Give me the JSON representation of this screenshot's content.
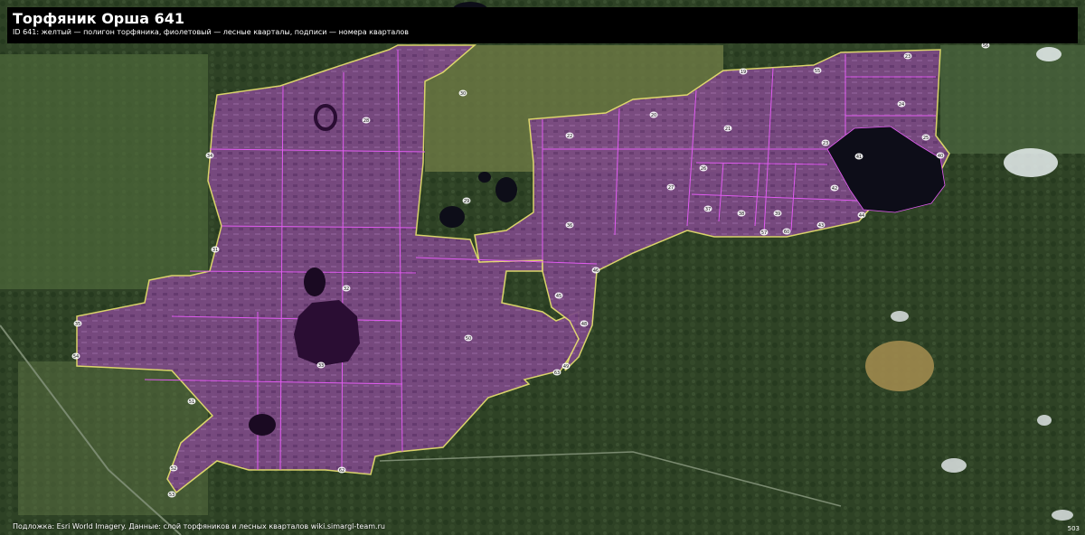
{
  "header": {
    "title": "Торфяник Орша 641",
    "subtitle": "ID 641: желтый — полигон торфяника, фиолетовый — лесные кварталы, подписи — номера кварталов"
  },
  "footer": {
    "attribution": "Подложка: Esri World Imagery. Данные: слой торфяников и лесных кварталов wiki.simargl-team.ru",
    "corner_label": "503"
  },
  "colors": {
    "peat_polygon": "#e8e070",
    "forest_quarter_fill": "#9a4fa8",
    "forest_quarter_line": "#e05bf0",
    "lake": "#0d0d18"
  },
  "quarter_labels": [
    "28",
    "31",
    "32",
    "33",
    "30",
    "34",
    "35",
    "23",
    "19",
    "20",
    "21",
    "22",
    "23",
    "24",
    "25",
    "26",
    "27",
    "29",
    "36",
    "37",
    "38",
    "39",
    "40",
    "41",
    "42",
    "43",
    "44",
    "45",
    "46",
    "48",
    "49",
    "50",
    "51",
    "52",
    "53",
    "54",
    "55",
    "56",
    "57",
    "60",
    "62",
    "63",
    "64",
    "65",
    "66",
    "67",
    "68",
    "69",
    "70",
    "80",
    "89",
    "90",
    "100",
    "106"
  ]
}
